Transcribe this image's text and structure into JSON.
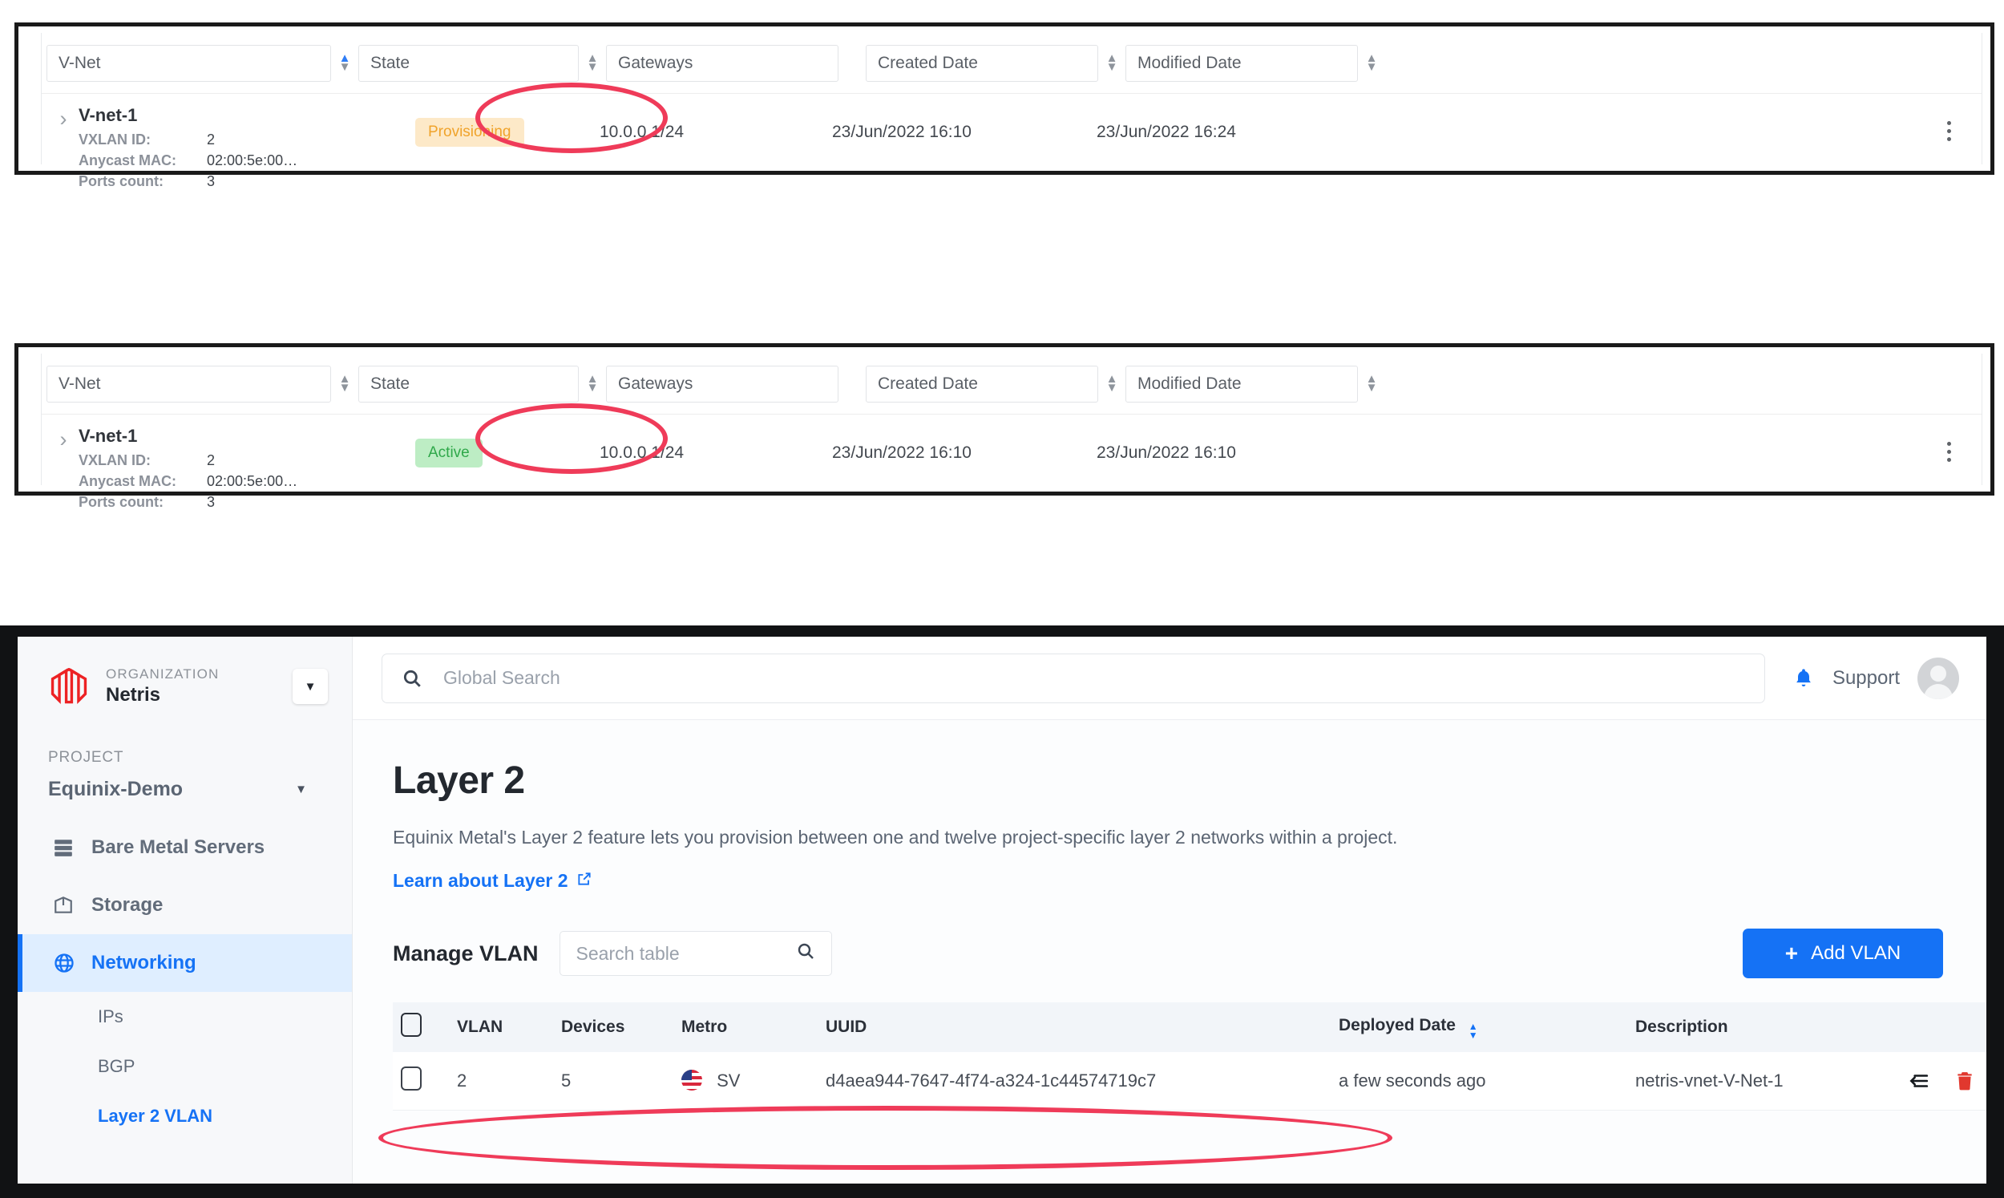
{
  "panels": [
    {
      "id": "provisioning-panel",
      "columns": [
        "V-Net",
        "State",
        "Gateways",
        "Created Date",
        "Modified Date"
      ],
      "sortable": [
        true,
        true,
        false,
        true,
        true
      ],
      "row": {
        "name": "V-net-1",
        "details": [
          {
            "label": "VXLAN ID:",
            "value": "2"
          },
          {
            "label": "Anycast MAC:",
            "value": "02:00:5e:00…"
          },
          {
            "label": "Ports count:",
            "value": "3"
          }
        ],
        "state": "Provisioning",
        "state_kind": "provisioning",
        "gateways": "10.0.0.1/24",
        "created": "23/Jun/2022 16:10",
        "modified": "23/Jun/2022 16:24"
      }
    },
    {
      "id": "active-panel",
      "columns": [
        "V-Net",
        "State",
        "Gateways",
        "Created Date",
        "Modified Date"
      ],
      "sortable": [
        true,
        true,
        false,
        true,
        true
      ],
      "row": {
        "name": "V-net-1",
        "details": [
          {
            "label": "VXLAN ID:",
            "value": "2"
          },
          {
            "label": "Anycast MAC:",
            "value": "02:00:5e:00…"
          },
          {
            "label": "Ports count:",
            "value": "3"
          }
        ],
        "state": "Active",
        "state_kind": "active",
        "gateways": "10.0.0.1/24",
        "created": "23/Jun/2022 16:10",
        "modified": "23/Jun/2022 16:10"
      }
    }
  ],
  "app": {
    "sidebar": {
      "org_kicker": "ORGANIZATION",
      "org_name": "Netris",
      "project_kicker": "PROJECT",
      "project_name": "Equinix-Demo",
      "items": [
        {
          "label": "Bare Metal Servers",
          "icon": "server-icon",
          "selected": false
        },
        {
          "label": "Storage",
          "icon": "storage-icon",
          "selected": false
        },
        {
          "label": "Networking",
          "icon": "globe-icon",
          "selected": true
        }
      ],
      "sub_items": [
        {
          "label": "IPs",
          "active": false
        },
        {
          "label": "BGP",
          "active": false
        },
        {
          "label": "Layer 2 VLAN",
          "active": true
        }
      ]
    },
    "topbar": {
      "search_placeholder": "Global Search",
      "support_label": "Support"
    },
    "main": {
      "title": "Layer 2",
      "description": "Equinix Metal's Layer 2 feature lets you provision between one and twelve project-specific layer 2 networks within a project.",
      "learn_link": "Learn about Layer 2",
      "manage_title": "Manage VLAN",
      "table_search_placeholder": "Search table",
      "add_button": "Add VLAN",
      "table": {
        "columns": [
          "VLAN",
          "Devices",
          "Metro",
          "UUID",
          "Deployed Date",
          "Description"
        ],
        "sorted_column": "Deployed Date",
        "rows": [
          {
            "vlan": "2",
            "devices": "5",
            "metro": "SV",
            "uuid": "d4aea944-7647-4f74-a324-1c44574719c7",
            "deployed": "a few seconds ago",
            "description": "netris-vnet-V-Net-1"
          }
        ]
      }
    }
  },
  "colors": {
    "accent_blue": "#1572f5",
    "highlight_red": "#ef3b59",
    "badge_provisioning_bg": "#fde9c8",
    "badge_provisioning_fg": "#f0a32b",
    "badge_active_bg": "#bdedc4",
    "badge_active_fg": "#2fa84a",
    "logo_red": "#ed2224",
    "trash_red": "#e1382e"
  }
}
